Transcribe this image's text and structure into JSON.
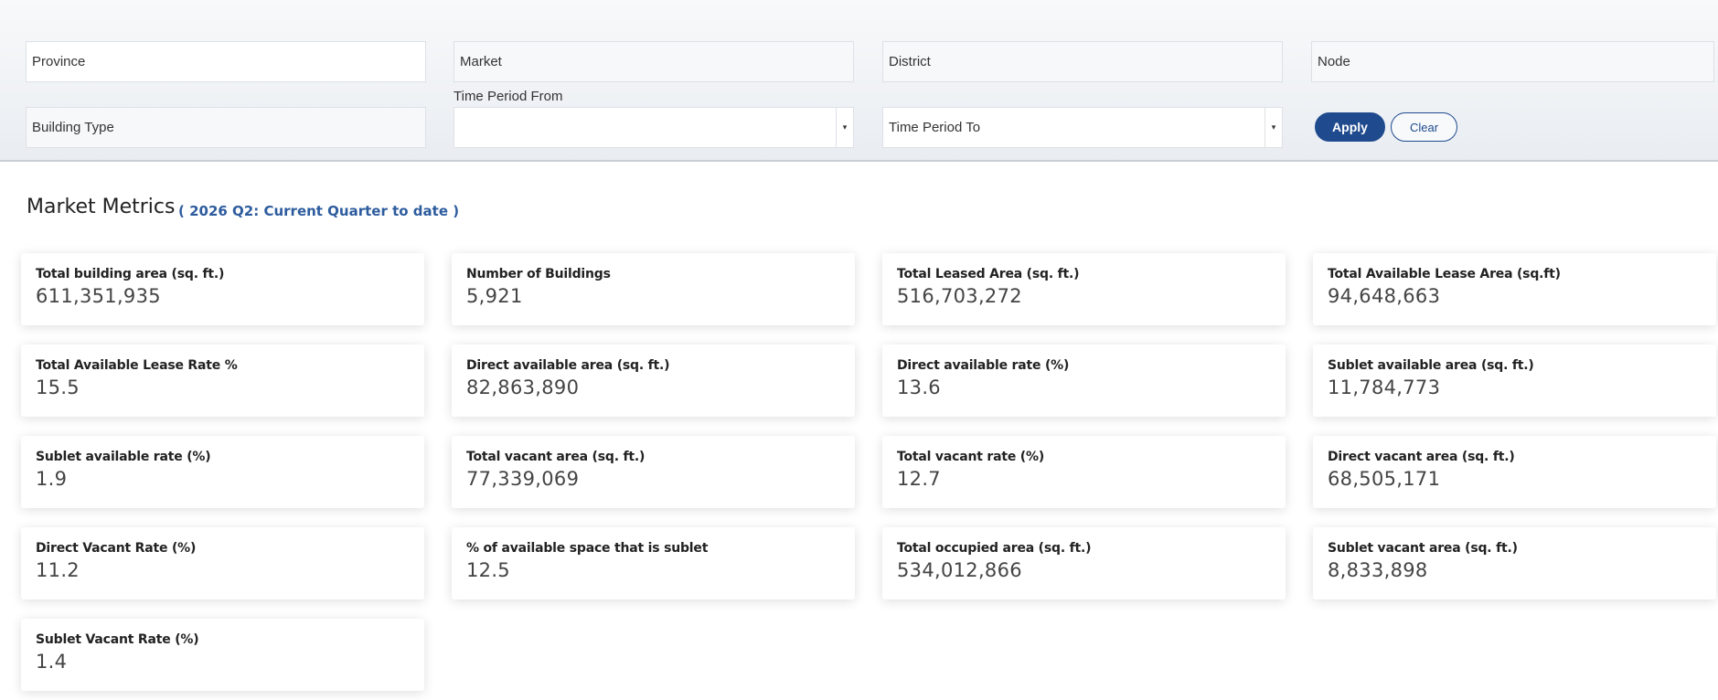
{
  "filters": {
    "province": "Province",
    "market": "Market",
    "district": "District",
    "node": "Node",
    "building_type": "Building Type",
    "time_from_label": "Time Period From",
    "time_from_value": "",
    "time_to": "Time Period To",
    "dropdown_icon": "▾"
  },
  "buttons": {
    "apply": "Apply",
    "clear": "Clear"
  },
  "section": {
    "title": "Market Metrics",
    "period": "( 2026 Q2: Current Quarter to date )"
  },
  "metrics": [
    {
      "label": "Total building area (sq. ft.)",
      "value": "611,351,935"
    },
    {
      "label": "Number of Buildings",
      "value": "5,921"
    },
    {
      "label": "Total Leased Area (sq. ft.)",
      "value": "516,703,272"
    },
    {
      "label": "Total Available Lease Area (sq.ft)",
      "value": "94,648,663"
    },
    {
      "label": "Total Available Lease Rate %",
      "value": "15.5"
    },
    {
      "label": "Direct available area (sq. ft.)",
      "value": "82,863,890"
    },
    {
      "label": "Direct available rate (%)",
      "value": "13.6"
    },
    {
      "label": "Sublet available area (sq. ft.)",
      "value": "11,784,773"
    },
    {
      "label": "Sublet available rate (%)",
      "value": "1.9"
    },
    {
      "label": "Total vacant area (sq. ft.)",
      "value": "77,339,069"
    },
    {
      "label": "Total vacant rate (%)",
      "value": "12.7"
    },
    {
      "label": "Direct vacant area (sq. ft.)",
      "value": "68,505,171"
    },
    {
      "label": "Direct Vacant Rate (%)",
      "value": "11.2"
    },
    {
      "label": "% of available space that is sublet",
      "value": "12.5"
    },
    {
      "label": "Total occupied area (sq. ft.)",
      "value": "534,012,866"
    },
    {
      "label": "Sublet vacant area (sq. ft.)",
      "value": "8,833,898"
    },
    {
      "label": "Sublet Vacant Rate (%)",
      "value": "1.4"
    }
  ]
}
